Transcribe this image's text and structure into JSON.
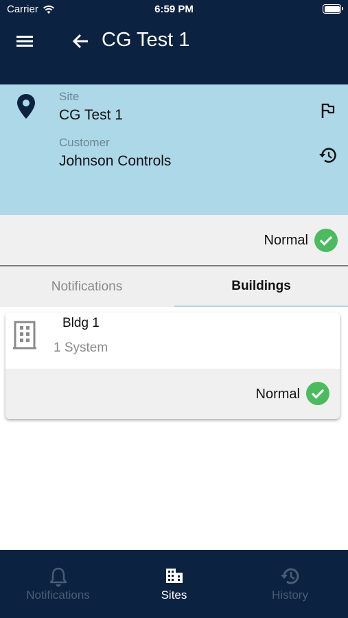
{
  "status_bar": {
    "carrier": "Carrier",
    "time": "6:59 PM"
  },
  "header": {
    "title": "CG Test 1",
    "menu_icon": "menu-icon",
    "back_icon": "arrow-left-icon"
  },
  "site": {
    "site_label": "Site",
    "site_value": "CG Test 1",
    "customer_label": "Customer",
    "customer_value": "Johnson Controls",
    "icons": [
      "map-pin-icon",
      "flag-icon",
      "history-icon"
    ]
  },
  "site_status": {
    "text": "Normal",
    "color": "#4cbb5e"
  },
  "tabs": [
    {
      "label": "Notifications",
      "active": false
    },
    {
      "label": "Buildings",
      "active": true
    }
  ],
  "buildings": [
    {
      "name": "Bldg 1",
      "systems": "1 System",
      "status": "Normal"
    }
  ],
  "bottom_nav": [
    {
      "label": "Notifications",
      "icon": "bell-icon",
      "active": false
    },
    {
      "label": "Sites",
      "icon": "building-icon",
      "active": true
    },
    {
      "label": "History",
      "icon": "history-icon",
      "active": false
    }
  ],
  "colors": {
    "navy": "#0b2341",
    "site_card": "#acd8e8",
    "status_green": "#4cbb5e"
  }
}
